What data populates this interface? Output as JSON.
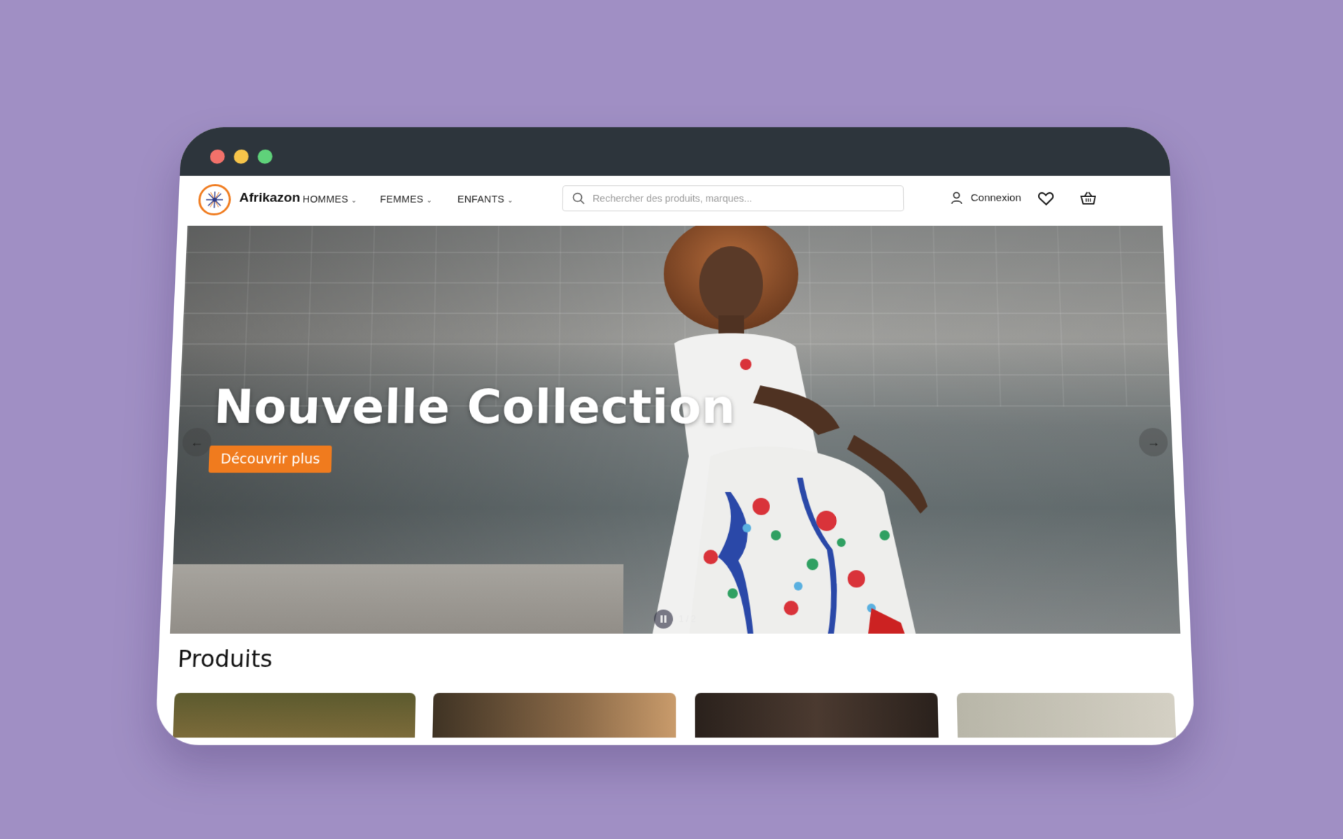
{
  "brand": {
    "name": "Afrikazon",
    "accent": "#f07b1e"
  },
  "nav": {
    "items": [
      {
        "label": "HOMMES"
      },
      {
        "label": "FEMMES"
      },
      {
        "label": "ENFANTS"
      }
    ]
  },
  "search": {
    "placeholder": "Rechercher des produits, marques..."
  },
  "account": {
    "login_label": "Connexion"
  },
  "hero": {
    "title": "Nouvelle Collection",
    "cta_label": "Découvrir plus",
    "pager_text": "1 / 2"
  },
  "products": {
    "section_title": "Produits"
  },
  "colors": {
    "background": "#a08fc4",
    "titlebar": "#2d353c",
    "cta": "#f07b1e"
  }
}
